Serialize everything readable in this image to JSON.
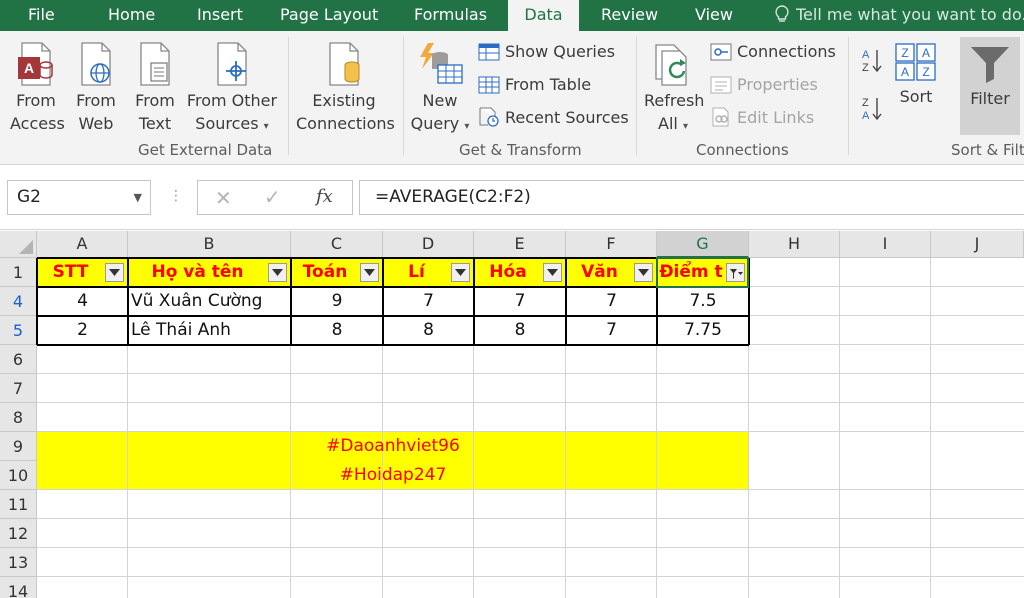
{
  "ribbon_tabs": [
    "File",
    "Home",
    "Insert",
    "Page Layout",
    "Formulas",
    "Data",
    "Review",
    "View"
  ],
  "tell_me": "Tell me what you want to do...",
  "get_external": {
    "from_access": [
      "From",
      "Access"
    ],
    "from_web": [
      "From",
      "Web"
    ],
    "from_text": [
      "From",
      "Text"
    ],
    "from_other": [
      "From Other",
      "Sources"
    ],
    "existing": [
      "Existing",
      "Connections"
    ],
    "group_label": "Get External Data"
  },
  "get_transform": {
    "new_query": [
      "New",
      "Query"
    ],
    "show_queries": "Show Queries",
    "from_table": "From Table",
    "recent_sources": "Recent Sources",
    "group_label": "Get & Transform"
  },
  "connections": {
    "refresh_all": [
      "Refresh",
      "All"
    ],
    "connections": "Connections",
    "properties": "Properties",
    "edit_links": "Edit Links",
    "group_label": "Connections"
  },
  "sort_filter": {
    "sort": "Sort",
    "filter": "Filter",
    "group_label": "Sort & Filt"
  },
  "formula_bar": {
    "name_box": "G2",
    "fx": "fx",
    "formula": "=AVERAGE(C2:F2)"
  },
  "sheet": {
    "columns": [
      "A",
      "B",
      "C",
      "D",
      "E",
      "F",
      "G",
      "H",
      "I",
      "J"
    ],
    "selected_column": "G",
    "row_numbers": [
      "1",
      "4",
      "5",
      "6",
      "7",
      "8",
      "9",
      "10",
      "11",
      "12",
      "13",
      "14"
    ],
    "headers": [
      "STT",
      "Họ và tên",
      "Toán",
      "Lí",
      "Hóa",
      "Văn",
      "Điểm t"
    ],
    "rows": [
      [
        "4",
        "Vũ Xuân Cường",
        "9",
        "7",
        "7",
        "7",
        "7.5"
      ],
      [
        "2",
        "Lê Thái Anh",
        "8",
        "8",
        "8",
        "7",
        "7.75"
      ]
    ],
    "banner_line1": "#Daoanhviet96",
    "banner_line2": "#Hoidap247"
  },
  "colors": {
    "excel_green": "#217346",
    "highlight_yellow": "#ffff00",
    "header_text_red": "#ff0000",
    "filtered_row_blue": "#1a5fd3"
  }
}
